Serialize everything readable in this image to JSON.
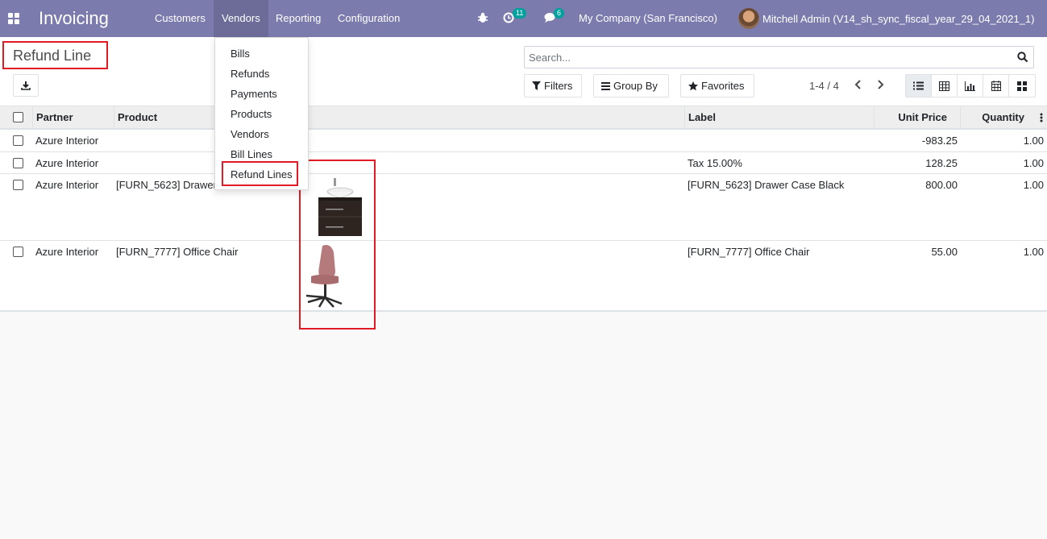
{
  "navbar": {
    "brand": "Invoicing",
    "menu": [
      "Customers",
      "Vendors",
      "Reporting",
      "Configuration"
    ],
    "activity_count": "11",
    "messages_count": "6",
    "company": "My Company (San Francisco)",
    "user": "Mitchell Admin (V14_sh_sync_fiscal_year_29_04_2021_1)"
  },
  "vendors_menu": {
    "items": [
      "Bills",
      "Refunds",
      "Payments",
      "Products",
      "Vendors",
      "Bill Lines",
      "Refund Lines"
    ]
  },
  "control_panel": {
    "title": "Refund Line",
    "search_placeholder": "Search...",
    "filters": "Filters",
    "group_by": "Group By",
    "favorites": "Favorites",
    "pager": "1-4 / 4"
  },
  "table": {
    "headers": {
      "partner": "Partner",
      "product": "Product",
      "label": "Label",
      "unit_price": "Unit Price",
      "quantity": "Quantity"
    },
    "rows": [
      {
        "partner": "Azure Interior",
        "product": "",
        "label": "",
        "unit_price": "-983.25",
        "quantity": "1.00"
      },
      {
        "partner": "Azure Interior",
        "product": "",
        "label": "Tax 15.00%",
        "unit_price": "128.25",
        "quantity": "1.00"
      },
      {
        "partner": "Azure Interior",
        "product": "[FURN_5623] Drawer Case Black",
        "label": "[FURN_5623] Drawer Case Black",
        "unit_price": "800.00",
        "quantity": "1.00"
      },
      {
        "partner": "Azure Interior",
        "product": "[FURN_7777] Office Chair",
        "label": "[FURN_7777] Office Chair",
        "unit_price": "55.00",
        "quantity": "1.00"
      }
    ]
  },
  "colors": {
    "navbar": "#7c7bad",
    "highlight": "#e01b24"
  }
}
